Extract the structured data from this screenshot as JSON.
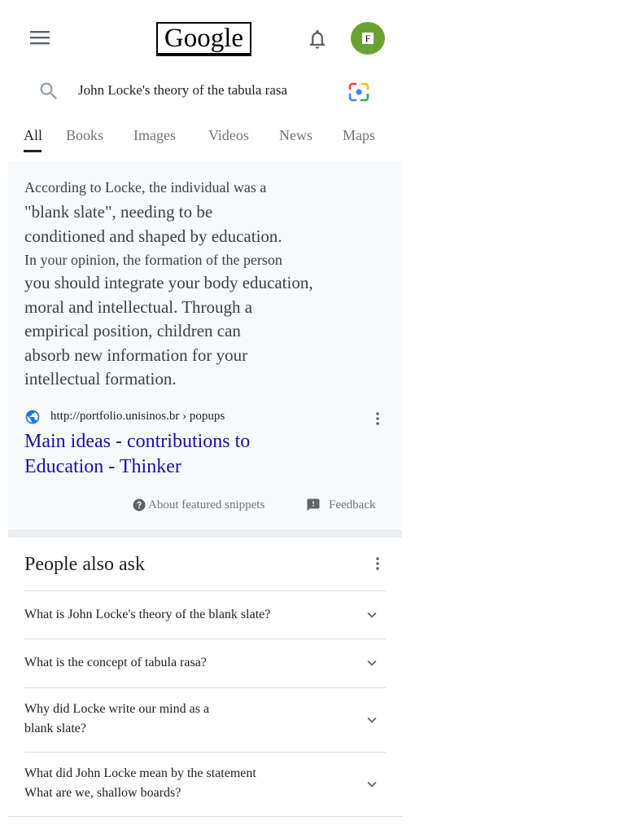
{
  "header": {
    "menu_icon": "hamburger-menu-icon",
    "logo_text": "Google",
    "bell_icon": "notification-bell-icon",
    "avatar_letter": "F",
    "avatar_color": "#6aa232"
  },
  "search": {
    "query": "John Locke's theory of the tabula rasa",
    "search_icon": "magnifier-icon",
    "lens_icon": "google-lens-icon"
  },
  "tabs": [
    {
      "label": "All",
      "active": true
    },
    {
      "label": "Books"
    },
    {
      "label": "Images"
    },
    {
      "label": "Videos"
    },
    {
      "label": "News"
    },
    {
      "label": "Maps"
    }
  ],
  "snippet": {
    "lines": [
      "According to Locke, the individual was a",
      "\"blank slate\", needing to be",
      "conditioned and shaped by education.",
      "In your opinion, the formation of the person",
      "you should integrate your body education,",
      "moral and intellectual. Through a",
      "empirical position, children can",
      "absorb new information for your",
      "intellectual formation."
    ],
    "source_url": "http://portfolio.unisinos.br › popups",
    "title_lines": [
      "Main ideas - contributions to",
      "Education - Thinker"
    ],
    "about_label": "About featured snippets",
    "feedback_label": "Feedback"
  },
  "people_also_ask": {
    "title": "People also ask",
    "questions": [
      [
        "What is John Locke's theory of the blank slate?"
      ],
      [
        "What is the concept of tabula rasa?"
      ],
      [
        "Why did Locke write our mind as a",
        "blank slate?"
      ],
      [
        "What did John Locke mean by the statement",
        "What are we, shallow boards?"
      ]
    ]
  },
  "colors": {
    "link": "#1a0dab",
    "snippet_bg": "#f8f9fa",
    "text": "#3c4043",
    "muted": "#70757a"
  }
}
